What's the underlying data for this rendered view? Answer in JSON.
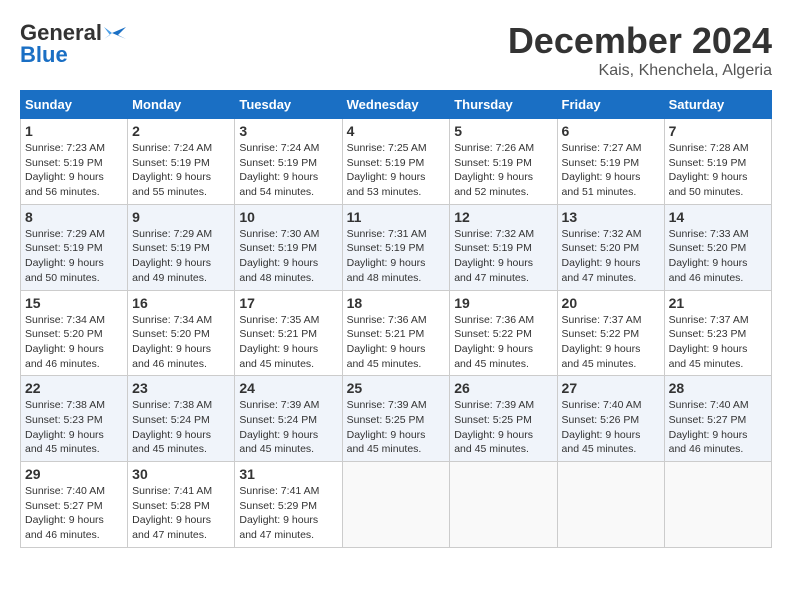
{
  "logo": {
    "line1": "General",
    "line2": "Blue"
  },
  "title": "December 2024",
  "subtitle": "Kais, Khenchela, Algeria",
  "weekdays": [
    "Sunday",
    "Monday",
    "Tuesday",
    "Wednesday",
    "Thursday",
    "Friday",
    "Saturday"
  ],
  "weeks": [
    [
      {
        "day": "1",
        "info": "Sunrise: 7:23 AM\nSunset: 5:19 PM\nDaylight: 9 hours and 56 minutes."
      },
      {
        "day": "2",
        "info": "Sunrise: 7:24 AM\nSunset: 5:19 PM\nDaylight: 9 hours and 55 minutes."
      },
      {
        "day": "3",
        "info": "Sunrise: 7:24 AM\nSunset: 5:19 PM\nDaylight: 9 hours and 54 minutes."
      },
      {
        "day": "4",
        "info": "Sunrise: 7:25 AM\nSunset: 5:19 PM\nDaylight: 9 hours and 53 minutes."
      },
      {
        "day": "5",
        "info": "Sunrise: 7:26 AM\nSunset: 5:19 PM\nDaylight: 9 hours and 52 minutes."
      },
      {
        "day": "6",
        "info": "Sunrise: 7:27 AM\nSunset: 5:19 PM\nDaylight: 9 hours and 51 minutes."
      },
      {
        "day": "7",
        "info": "Sunrise: 7:28 AM\nSunset: 5:19 PM\nDaylight: 9 hours and 50 minutes."
      }
    ],
    [
      {
        "day": "8",
        "info": "Sunrise: 7:29 AM\nSunset: 5:19 PM\nDaylight: 9 hours and 50 minutes."
      },
      {
        "day": "9",
        "info": "Sunrise: 7:29 AM\nSunset: 5:19 PM\nDaylight: 9 hours and 49 minutes."
      },
      {
        "day": "10",
        "info": "Sunrise: 7:30 AM\nSunset: 5:19 PM\nDaylight: 9 hours and 48 minutes."
      },
      {
        "day": "11",
        "info": "Sunrise: 7:31 AM\nSunset: 5:19 PM\nDaylight: 9 hours and 48 minutes."
      },
      {
        "day": "12",
        "info": "Sunrise: 7:32 AM\nSunset: 5:19 PM\nDaylight: 9 hours and 47 minutes."
      },
      {
        "day": "13",
        "info": "Sunrise: 7:32 AM\nSunset: 5:20 PM\nDaylight: 9 hours and 47 minutes."
      },
      {
        "day": "14",
        "info": "Sunrise: 7:33 AM\nSunset: 5:20 PM\nDaylight: 9 hours and 46 minutes."
      }
    ],
    [
      {
        "day": "15",
        "info": "Sunrise: 7:34 AM\nSunset: 5:20 PM\nDaylight: 9 hours and 46 minutes."
      },
      {
        "day": "16",
        "info": "Sunrise: 7:34 AM\nSunset: 5:20 PM\nDaylight: 9 hours and 46 minutes."
      },
      {
        "day": "17",
        "info": "Sunrise: 7:35 AM\nSunset: 5:21 PM\nDaylight: 9 hours and 45 minutes."
      },
      {
        "day": "18",
        "info": "Sunrise: 7:36 AM\nSunset: 5:21 PM\nDaylight: 9 hours and 45 minutes."
      },
      {
        "day": "19",
        "info": "Sunrise: 7:36 AM\nSunset: 5:22 PM\nDaylight: 9 hours and 45 minutes."
      },
      {
        "day": "20",
        "info": "Sunrise: 7:37 AM\nSunset: 5:22 PM\nDaylight: 9 hours and 45 minutes."
      },
      {
        "day": "21",
        "info": "Sunrise: 7:37 AM\nSunset: 5:23 PM\nDaylight: 9 hours and 45 minutes."
      }
    ],
    [
      {
        "day": "22",
        "info": "Sunrise: 7:38 AM\nSunset: 5:23 PM\nDaylight: 9 hours and 45 minutes."
      },
      {
        "day": "23",
        "info": "Sunrise: 7:38 AM\nSunset: 5:24 PM\nDaylight: 9 hours and 45 minutes."
      },
      {
        "day": "24",
        "info": "Sunrise: 7:39 AM\nSunset: 5:24 PM\nDaylight: 9 hours and 45 minutes."
      },
      {
        "day": "25",
        "info": "Sunrise: 7:39 AM\nSunset: 5:25 PM\nDaylight: 9 hours and 45 minutes."
      },
      {
        "day": "26",
        "info": "Sunrise: 7:39 AM\nSunset: 5:25 PM\nDaylight: 9 hours and 45 minutes."
      },
      {
        "day": "27",
        "info": "Sunrise: 7:40 AM\nSunset: 5:26 PM\nDaylight: 9 hours and 45 minutes."
      },
      {
        "day": "28",
        "info": "Sunrise: 7:40 AM\nSunset: 5:27 PM\nDaylight: 9 hours and 46 minutes."
      }
    ],
    [
      {
        "day": "29",
        "info": "Sunrise: 7:40 AM\nSunset: 5:27 PM\nDaylight: 9 hours and 46 minutes."
      },
      {
        "day": "30",
        "info": "Sunrise: 7:41 AM\nSunset: 5:28 PM\nDaylight: 9 hours and 47 minutes."
      },
      {
        "day": "31",
        "info": "Sunrise: 7:41 AM\nSunset: 5:29 PM\nDaylight: 9 hours and 47 minutes."
      },
      null,
      null,
      null,
      null
    ]
  ]
}
